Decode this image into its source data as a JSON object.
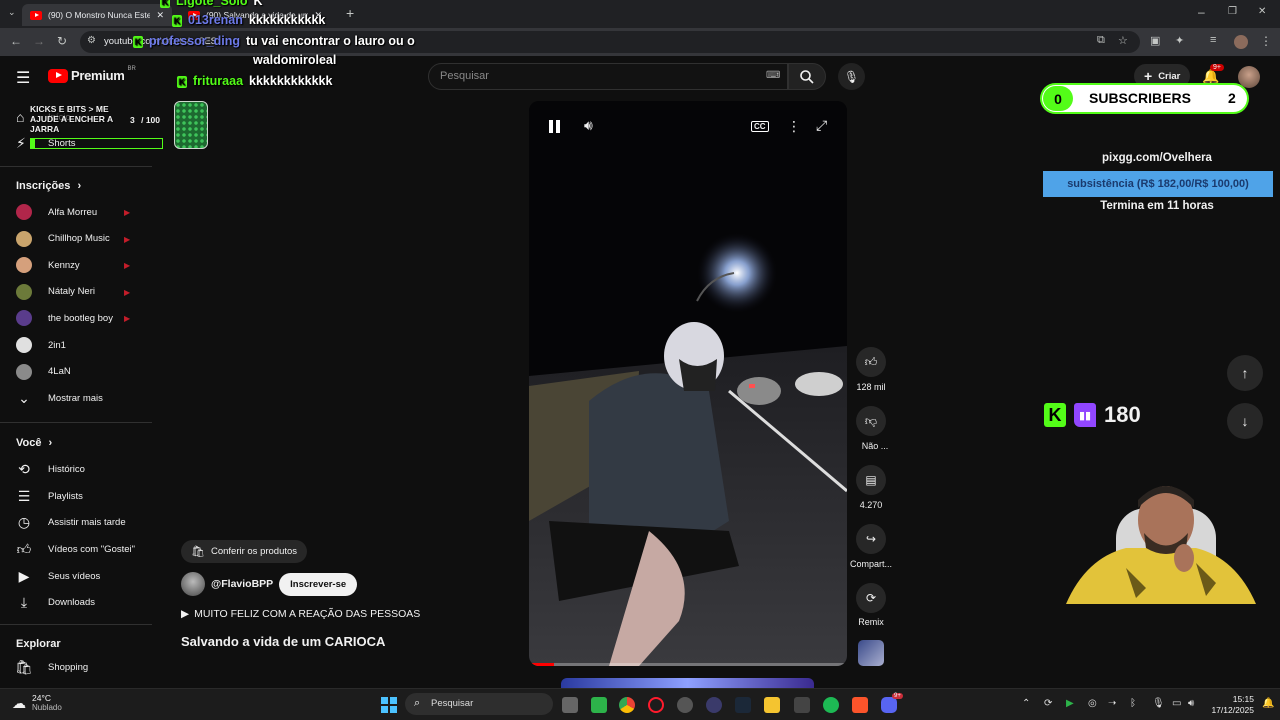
{
  "browser": {
    "tabs": [
      {
        "title": "(90) O Monstro Nunca Esteve n"
      },
      {
        "title": "(90) Salvando a vida de um"
      }
    ],
    "url": "youtube.com/shorts/…8ES"
  },
  "chat": [
    {
      "name": "Ligote_Solo",
      "msg": "K",
      "color": "green"
    },
    {
      "name": "013renan",
      "msg": "kkkkkkkkkkk",
      "color": "blue"
    },
    {
      "name": "professor_ding",
      "msg": "tu vai encontrar o lauro ou o",
      "color": "blue"
    },
    {
      "name": "",
      "msg": "waldomiroleal",
      "color": "green"
    },
    {
      "name": "frituraaa",
      "msg": "kkkkkkkkkkkk",
      "color": "green"
    }
  ],
  "goal": {
    "title": "KICKS E BITS > ME AJUDE A ENCHER A JARRA",
    "count": "3",
    "max": "/ 100"
  },
  "yt": {
    "logo": "Premium",
    "region": "BR",
    "search_placeholder": "Pesquisar",
    "create_label": "Criar",
    "notif_badge": "9+"
  },
  "sidebar": {
    "top": [
      {
        "label": "Início"
      },
      {
        "label": "Shorts"
      }
    ],
    "subs_title": "Inscrições",
    "subs": [
      {
        "label": "Alfa Morreu",
        "color": "#b1264a",
        "live": true
      },
      {
        "label": "Chillhop Music",
        "color": "#c9a46c",
        "live": true
      },
      {
        "label": "Kennzy",
        "color": "#d5a07c",
        "live": true
      },
      {
        "label": "Nátaly Neri",
        "color": "#6c7a3a",
        "live": true
      },
      {
        "label": "the bootleg boy",
        "color": "#5a3c8c",
        "live": true
      },
      {
        "label": "2in1",
        "color": "#e0e0e0",
        "live": false
      },
      {
        "label": "4LaN",
        "color": "#8a8a8a",
        "live": false
      },
      {
        "label": "Mostrar mais",
        "color": "",
        "live": false
      }
    ],
    "you_title": "Você",
    "you": [
      {
        "label": "Histórico"
      },
      {
        "label": "Playlists"
      },
      {
        "label": "Assistir mais tarde"
      },
      {
        "label": "Vídeos com \"Gostei\""
      },
      {
        "label": "Seus vídeos"
      },
      {
        "label": "Downloads"
      }
    ],
    "explore_title": "Explorar",
    "explore": [
      {
        "label": "Shopping"
      }
    ]
  },
  "video": {
    "products_label": "Conferir os produtos",
    "channel": "@FlavioBPP",
    "subscribe_label": "Inscrever-se",
    "song": "MUITO FELIZ COM A REAÇÃO DAS PESSOAS",
    "title": "Salvando a vida de um CARIOCA",
    "progress": 0.08,
    "actions": [
      {
        "label": "128 mil"
      },
      {
        "label": "Não ..."
      },
      {
        "label": "4.270"
      },
      {
        "label": "Compart..."
      },
      {
        "label": "Remix"
      }
    ]
  },
  "stream": {
    "subs_count": "0",
    "subs_label": "SUBSCRIBERS",
    "subs_goal": "2",
    "pix_url": "pixgg.com/Ovelhera",
    "pix_goal": "subsistência (R$ 182,00/R$ 100,00)",
    "pix_time": "Termina em 11 horas",
    "viewers": "180"
  },
  "taskbar": {
    "weather_temp": "24°C",
    "weather_desc": "Nublado",
    "search_placeholder": "Pesquisar",
    "time": "15:15",
    "date": "17/12/2025",
    "badge_discord": "9+"
  },
  "colors": {
    "accent": "#ff0000",
    "kick": "#53fc18",
    "pix": "#4fa3e8"
  }
}
